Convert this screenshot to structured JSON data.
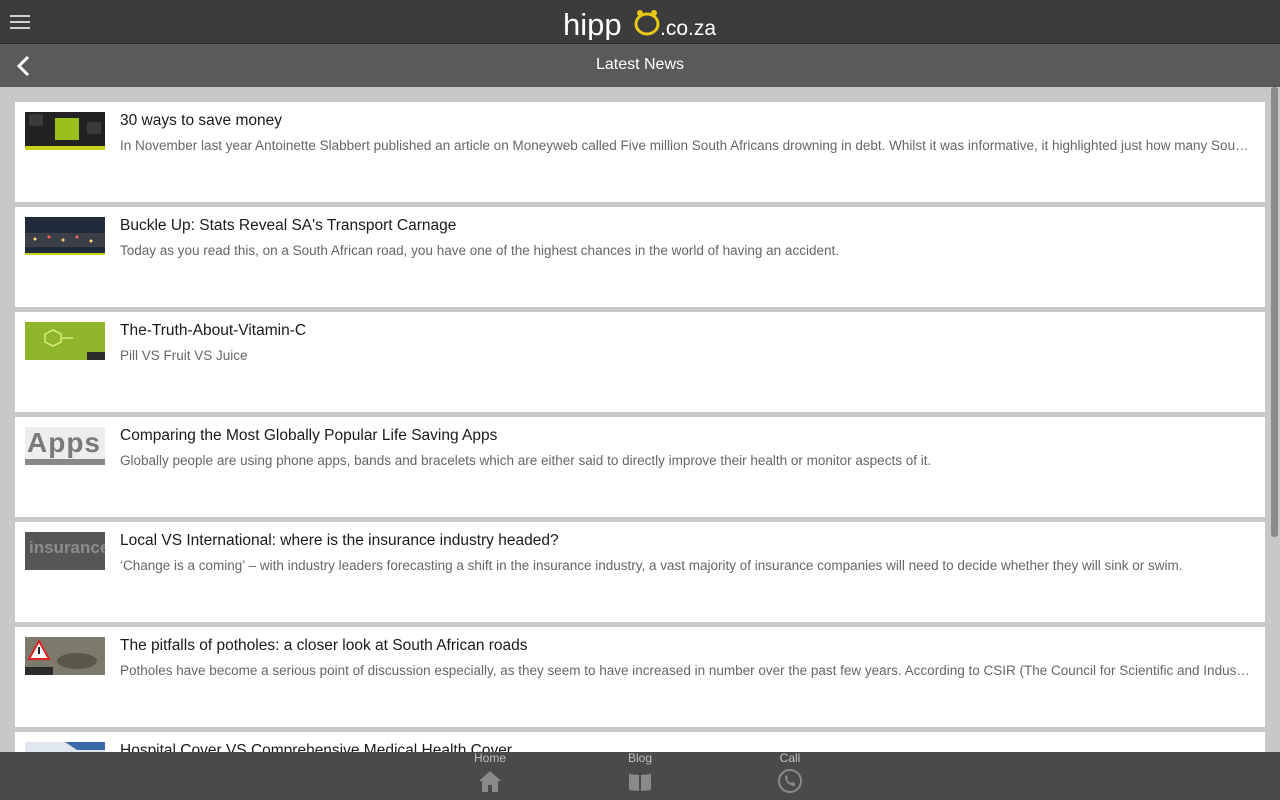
{
  "app": {
    "logo_main": "hippÖ",
    "logo_suffix": ".co.za"
  },
  "header": {
    "title": "Latest News"
  },
  "articles": [
    {
      "title": "30 ways to save money",
      "description": "In November last year Antoinette Slabbert published an article on Moneyweb called Five million South Africans drowning in debt. Whilst it was informative, it highlighted just how many South Africans are in trouble with debt."
    },
    {
      "title": "Buckle Up: Stats Reveal SA's Transport Carnage",
      "description": "Today as you read this, on a South African road, you have one of the highest chances in the world of having an accident."
    },
    {
      "title": "The-Truth-About-Vitamin-C",
      "description": "Pill VS Fruit VS Juice"
    },
    {
      "title": "Comparing the Most Globally Popular Life Saving Apps",
      "description": "Globally people are using phone apps, bands and bracelets which are either said to directly improve their health or monitor aspects of it."
    },
    {
      "title": "Local VS International: where is the insurance industry headed?",
      "description": "‘Change is a coming’ – with industry leaders forecasting a shift in the insurance industry, a vast majority of insurance companies will need to decide whether they will sink or swim."
    },
    {
      "title": "The pitfalls of potholes: a closer look at South African roads",
      "description": "Potholes have become a serious point of discussion especially, as they seem to have increased in number over the past few years. According to CSIR (The Council for Scientific and Industrial Research)"
    },
    {
      "title": "Hospital Cover VS Comprehensive Medical Health Cover",
      "description": ""
    }
  ],
  "thumbs": {
    "apps_text": "Apps",
    "insurance_text": "insurance"
  },
  "bottom_nav": {
    "home_label": "Home",
    "blog_label": "Blog",
    "call_label": "Call"
  },
  "colors": {
    "topbar": "#3c3c3c",
    "titlebar": "#5a5a5a",
    "bottomnav": "#4a4a4a",
    "logo_accent": "#e8c817"
  }
}
